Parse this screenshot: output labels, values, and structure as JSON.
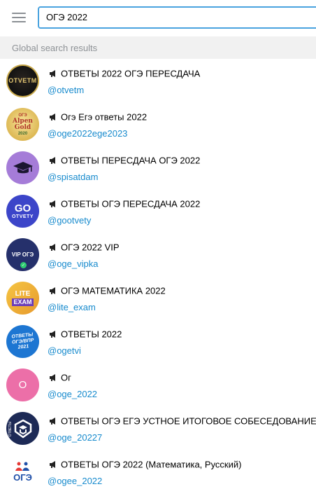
{
  "search": {
    "value": "ОГЭ 2022"
  },
  "section": {
    "title": "Global search results"
  },
  "colors": {
    "accent": "#4aa3df",
    "handle": "#168acd",
    "header_bg": "#f1f1f1"
  },
  "results": [
    {
      "title": "ОТВЕТЫ 2022 ОГЭ ПЕРЕСДАЧА",
      "handle": "@otvetm",
      "avatar_text": "OTVETM"
    },
    {
      "title": "Огэ Егэ ответы 2022",
      "handle": "@oge2022ege2023",
      "avatar_top": "ОГЭ",
      "avatar_mid": "Alpen Gold",
      "avatar_bottom": "2020"
    },
    {
      "title": "ОТВЕТЫ ПЕРЕСДАЧА ОГЭ 2022",
      "handle": "@spisatdam",
      "avatar_icon": "graduation-cap-icon"
    },
    {
      "title": "ОТВЕТЫ ОГЭ ПЕРЕСДАЧА 2022",
      "handle": "@gootvety",
      "avatar_top": "GO",
      "avatar_bottom": "OTVETY"
    },
    {
      "title": "ОГЭ 2022 VIP",
      "handle": "@oge_vipka",
      "avatar_text": "VIP ОГЭ"
    },
    {
      "title": "ОГЭ МАТЕМАТИКА 2022",
      "handle": "@lite_exam",
      "avatar_top": "LITE",
      "avatar_bottom": "EXAM"
    },
    {
      "title": "ОТВЕТЫ 2022",
      "handle": "@ogetvi",
      "avatar_lines": [
        "ОТВЕТЫ",
        "ОГЭ/ВПР",
        "2021"
      ]
    },
    {
      "title": "Ог",
      "handle": "@oge_2022",
      "avatar_text": "О"
    },
    {
      "title": "ОТВЕТЫ ОГЭ ЕГЭ УСТНОЕ ИТОГОВОЕ СОБЕСЕДОВАНИЕ",
      "handle": "@oge_20227",
      "avatar_side": "ОТВЕТЫ"
    },
    {
      "title": "ОТВЕТЫ ОГЭ 2022 (Математика, Русский)",
      "handle": "@ogee_2022",
      "avatar_text": "ОГЭ"
    }
  ]
}
